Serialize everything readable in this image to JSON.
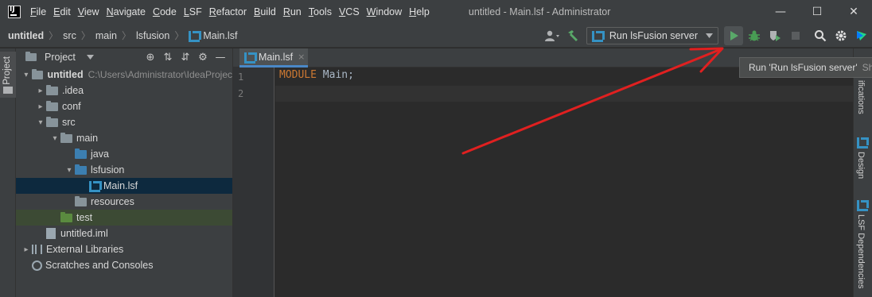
{
  "titlebar": {
    "menu": [
      "File",
      "Edit",
      "View",
      "Navigate",
      "Code",
      "LSF",
      "Refactor",
      "Build",
      "Run",
      "Tools",
      "VCS",
      "Window",
      "Help"
    ],
    "window_title": "untitled - Main.lsf - Administrator",
    "minimize": "—",
    "maximize": "☐",
    "close": "✕"
  },
  "navbar": {
    "crumbs": [
      "untitled",
      "src",
      "main",
      "lsfusion",
      "Main.lsf"
    ],
    "run_config": "Run lsFusion server"
  },
  "project": {
    "title": "Project",
    "left_tab": "Project",
    "tree": [
      {
        "label": "untitled",
        "path": "C:\\Users\\Administrator\\IdeaProjec",
        "indent": 0,
        "expanded": true,
        "icon": "folder-icon"
      },
      {
        "label": ".idea",
        "indent": 1,
        "expanded": false,
        "icon": "folder-icon"
      },
      {
        "label": "conf",
        "indent": 1,
        "expanded": false,
        "icon": "folder-icon"
      },
      {
        "label": "src",
        "indent": 1,
        "expanded": true,
        "icon": "folder-icon"
      },
      {
        "label": "main",
        "indent": 2,
        "expanded": true,
        "icon": "folder-icon"
      },
      {
        "label": "java",
        "indent": 3,
        "icon": "source-folder-icon"
      },
      {
        "label": "lsfusion",
        "indent": 3,
        "expanded": true,
        "icon": "source-folder-icon"
      },
      {
        "label": "Main.lsf",
        "indent": 4,
        "icon": "lsf-file-icon",
        "selected": true
      },
      {
        "label": "resources",
        "indent": 3,
        "icon": "resources-folder-icon"
      },
      {
        "label": "test",
        "indent": 2,
        "icon": "test-folder-icon",
        "test": true
      },
      {
        "label": "untitled.iml",
        "indent": 1,
        "icon": "iml-file-icon"
      },
      {
        "label": "External Libraries",
        "indent": 0,
        "expanded": false,
        "icon": "library-icon"
      },
      {
        "label": "Scratches and Consoles",
        "indent": 0,
        "icon": "scratches-icon"
      }
    ]
  },
  "editor": {
    "tab_label": "Main.lsf",
    "tab_close": "×",
    "line_numbers": [
      "1",
      "2"
    ],
    "code_keyword": "MODULE",
    "code_rest": " Main;"
  },
  "right_strip": {
    "notifications": "ifications",
    "design": "Design",
    "lsf_dependencies": "LSF Dependencies"
  },
  "tooltip": {
    "text": "Run 'Run lsFusion server'",
    "shortcut": "Shift"
  },
  "colors": {
    "run_green": "#59a869",
    "debug_green": "#499c54",
    "build_green": "#59a869",
    "arrow_red": "#e02020",
    "lsf_blue": "#3592c4",
    "keyword_orange": "#cc7832"
  }
}
